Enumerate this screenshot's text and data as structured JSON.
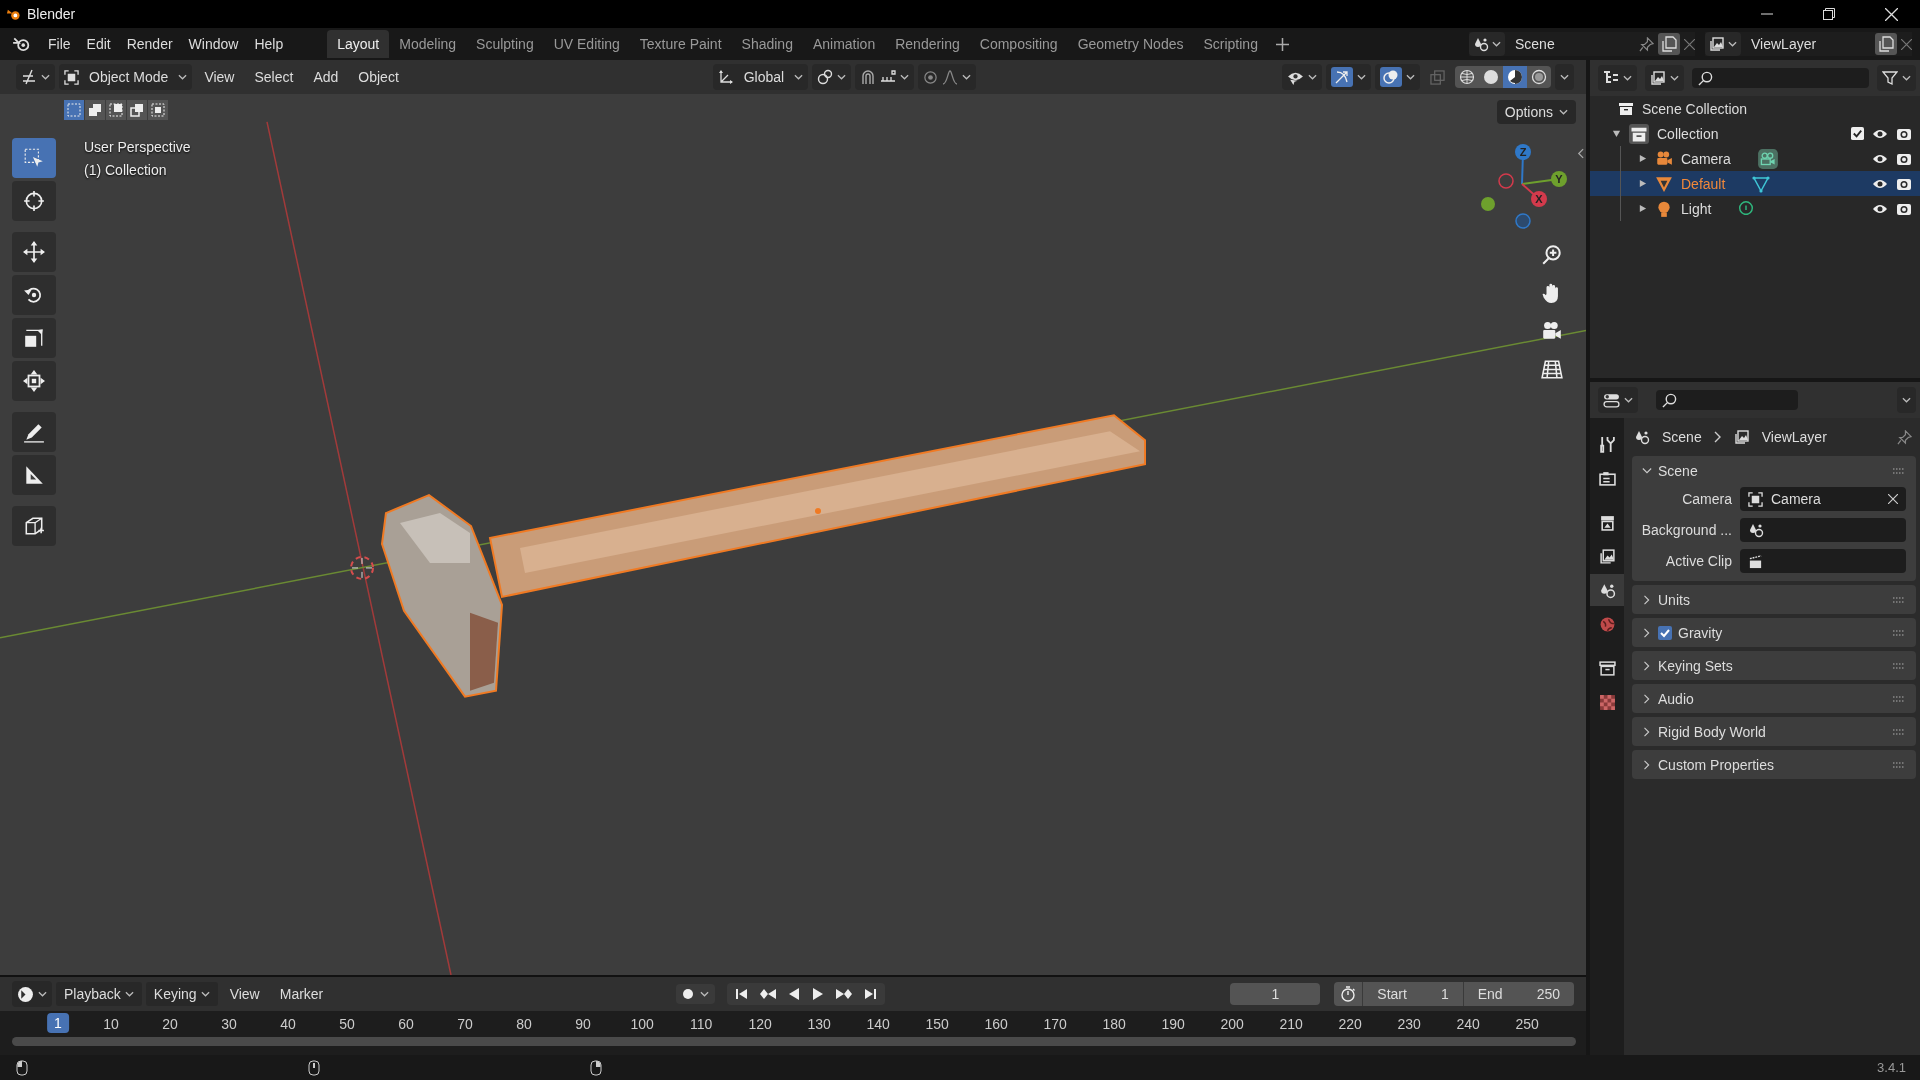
{
  "window": {
    "title": "Blender"
  },
  "menu": [
    "File",
    "Edit",
    "Render",
    "Window",
    "Help"
  ],
  "workspaces": [
    {
      "label": "Layout",
      "selected": true
    },
    {
      "label": "Modeling",
      "selected": false
    },
    {
      "label": "Sculpting",
      "selected": false
    },
    {
      "label": "UV Editing",
      "selected": false
    },
    {
      "label": "Texture Paint",
      "selected": false
    },
    {
      "label": "Shading",
      "selected": false
    },
    {
      "label": "Animation",
      "selected": false
    },
    {
      "label": "Rendering",
      "selected": false
    },
    {
      "label": "Compositing",
      "selected": false
    },
    {
      "label": "Geometry Nodes",
      "selected": false
    },
    {
      "label": "Scripting",
      "selected": false
    }
  ],
  "scene": "Scene",
  "view_layer": "ViewLayer",
  "viewport": {
    "mode": "Object Mode",
    "menus": [
      "View",
      "Select",
      "Add",
      "Object"
    ],
    "orientation": "Global",
    "gizmos_on": true,
    "overlays_on": true,
    "shading": [
      {
        "kind": "wireframe",
        "selected": false
      },
      {
        "kind": "solid",
        "selected": false
      },
      {
        "kind": "material",
        "selected": true
      },
      {
        "kind": "rendered",
        "selected": false
      }
    ],
    "select_modes": [
      {
        "selected": true
      },
      {
        "selected": false
      },
      {
        "selected": false
      },
      {
        "selected": false
      },
      {
        "selected": false
      }
    ],
    "options": "Options",
    "info": [
      "User Perspective",
      "(1) Collection"
    ],
    "axes": [
      "X",
      "Y",
      "Z"
    ],
    "tools": [
      {
        "kind": "select",
        "selected": true
      },
      {
        "kind": "cursor",
        "selected": false
      },
      {
        "kind": "move",
        "selected": false
      },
      {
        "kind": "rotate",
        "selected": false
      },
      {
        "kind": "scale",
        "selected": false
      },
      {
        "kind": "transform",
        "selected": false
      },
      {
        "kind": "annotate",
        "selected": false
      },
      {
        "kind": "measure",
        "selected": false
      },
      {
        "kind": "add_cube",
        "selected": false
      }
    ]
  },
  "outliner": {
    "root": "Scene Collection",
    "items": [
      {
        "label": "Collection",
        "kind": "collection",
        "expanded": true,
        "selected": false,
        "checked": true,
        "children": [
          {
            "label": "Camera",
            "kind": "camera",
            "expanded": false,
            "selected": false
          },
          {
            "label": "Default",
            "kind": "mesh",
            "expanded": false,
            "selected": true
          },
          {
            "label": "Light",
            "kind": "light",
            "expanded": false,
            "selected": false
          }
        ]
      }
    ]
  },
  "properties": {
    "tabs": [
      {
        "kind": "tool",
        "selected": false
      },
      {
        "kind": "render",
        "selected": false
      },
      {
        "kind": "output",
        "selected": false
      },
      {
        "kind": "view_layer",
        "selected": false
      },
      {
        "kind": "scene",
        "selected": true
      },
      {
        "kind": "world",
        "selected": false
      },
      {
        "kind": "collection",
        "selected": false
      },
      {
        "kind": "texture",
        "selected": false
      }
    ],
    "breadcrumb": [
      "Scene",
      "ViewLayer"
    ],
    "panels": [
      {
        "title": "Scene",
        "expanded": true,
        "fields": [
          {
            "label": "Camera",
            "kind": "camera",
            "value": "Camera"
          },
          {
            "label": "Background ...",
            "kind": "scene"
          },
          {
            "label": "Active Clip",
            "kind": "clip"
          }
        ]
      },
      {
        "title": "Units",
        "expanded": false
      },
      {
        "title": "Gravity",
        "expanded": false,
        "kind": "checkbox",
        "checked": true
      },
      {
        "title": "Keying Sets",
        "expanded": false
      },
      {
        "title": "Audio",
        "expanded": false
      },
      {
        "title": "Rigid Body World",
        "expanded": false
      },
      {
        "title": "Custom Properties",
        "expanded": false
      }
    ]
  },
  "timeline": {
    "menus": [
      {
        "label": "Playback",
        "dropdown": true
      },
      {
        "label": "Keying",
        "dropdown": true
      },
      {
        "label": "View",
        "dropdown": false
      },
      {
        "label": "Marker",
        "dropdown": false
      }
    ],
    "current_frame": "1",
    "start_label": "Start",
    "start": "1",
    "end_label": "End",
    "end": "250",
    "playhead": "1",
    "ruler": [
      "10",
      "20",
      "30",
      "40",
      "50",
      "60",
      "70",
      "80",
      "90",
      "100",
      "110",
      "120",
      "130",
      "140",
      "150",
      "160",
      "170",
      "180",
      "190",
      "200",
      "210",
      "220",
      "230",
      "240",
      "250"
    ]
  },
  "status_bar": {
    "version": "3.4.1"
  }
}
